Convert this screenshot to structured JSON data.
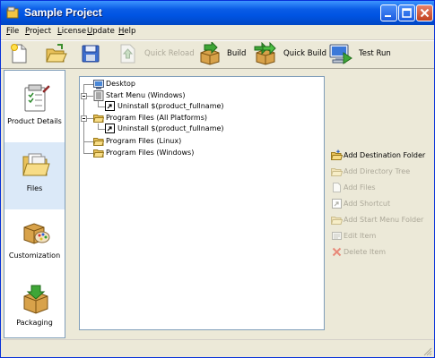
{
  "window": {
    "title": "Sample Project"
  },
  "menu": [
    {
      "key": "F",
      "rest": "ile"
    },
    {
      "key": "P",
      "rest": "roject"
    },
    {
      "key": "L",
      "rest": "icense"
    },
    {
      "key": "U",
      "rest": "pdate"
    },
    {
      "key": "H",
      "rest": "elp"
    }
  ],
  "toolbar": {
    "quick_reload": "Quick Reload",
    "build": "Build",
    "quick_build": "Quick Build",
    "test_run": "Test Run"
  },
  "sidebar": {
    "product_details": "Product Details",
    "files": "Files",
    "customization": "Customization",
    "packaging": "Packaging"
  },
  "tree": {
    "desktop": "Desktop",
    "start_menu": "Start Menu (Windows)",
    "uninstall_1": "Uninstall $(product_fullname)",
    "program_files_all": "Program Files (All Platforms)",
    "uninstall_2": "Uninstall $(product_fullname)",
    "program_files_linux": "Program Files (Linux)",
    "program_files_windows": "Program Files (Windows)"
  },
  "actions": {
    "add_destination_folder": "Add Destination Folder",
    "add_directory_tree": "Add Directory Tree",
    "add_files": "Add Files",
    "add_shortcut": "Add Shortcut",
    "add_start_menu_folder": "Add Start Menu Folder",
    "edit_item": "Edit Item",
    "delete_item": "Delete Item"
  },
  "colors": {
    "title_bar": "#0054e3",
    "window_bg": "#ece9d8",
    "selected_item": "#dbe9f8",
    "disabled_text": "#aca899"
  }
}
